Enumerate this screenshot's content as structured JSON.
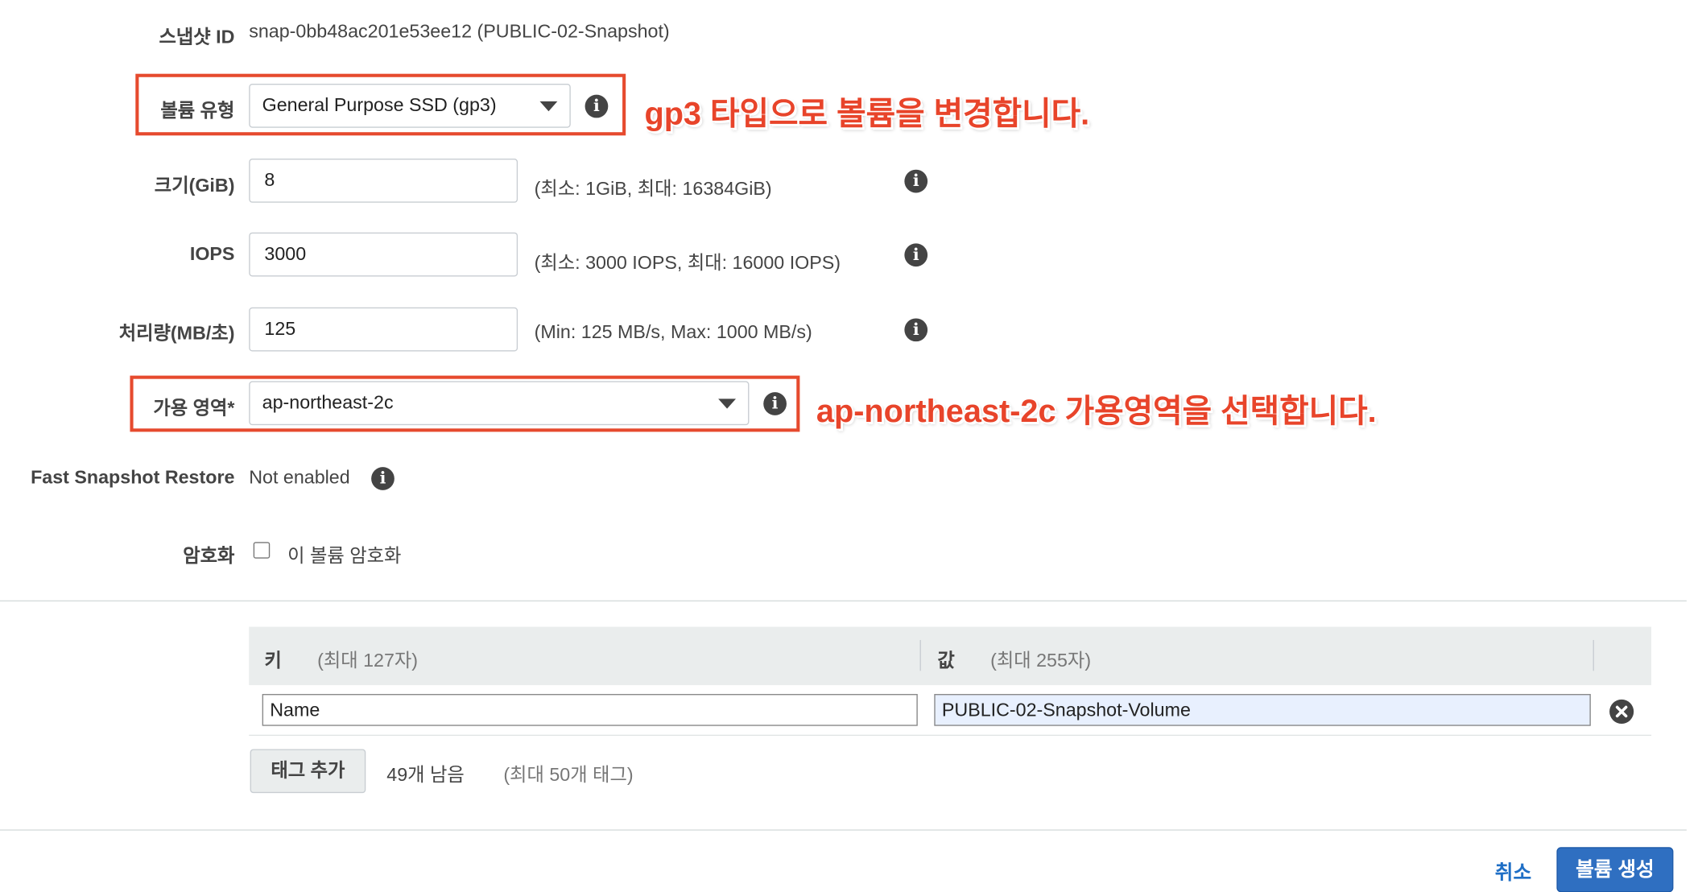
{
  "snapshot": {
    "label": "스냅샷 ID",
    "value": "snap-0bb48ac201e53ee12 (PUBLIC-02-Snapshot)"
  },
  "volume_type": {
    "label": "볼륨 유형",
    "value": "General Purpose SSD (gp3)"
  },
  "size": {
    "label": "크기(GiB)",
    "value": "8",
    "hint": "(최소: 1GiB, 최대: 16384GiB)"
  },
  "iops": {
    "label": "IOPS",
    "value": "3000",
    "hint": "(최소: 3000 IOPS, 최대: 16000 IOPS)"
  },
  "throughput": {
    "label": "처리량(MB/초)",
    "value": "125",
    "hint": "(Min: 125 MB/s, Max: 1000 MB/s)"
  },
  "availability_zone": {
    "label": "가용 영역*",
    "value": "ap-northeast-2c"
  },
  "fast_snapshot_restore": {
    "label": "Fast Snapshot Restore",
    "value": "Not enabled"
  },
  "encryption": {
    "label": "암호화",
    "checkbox_label": "이 볼륨 암호화",
    "checked": false
  },
  "annotations": {
    "volume_type_note": "gp3 타입으로 볼륨을 변경합니다.",
    "az_note": "ap-northeast-2c 가용영역을 선택합니다."
  },
  "tags": {
    "key_header": "키",
    "key_hint": "(최대 127자)",
    "value_header": "값",
    "value_hint": "(최대 255자)",
    "rows": [
      {
        "key": "Name",
        "value": "PUBLIC-02-Snapshot-Volume"
      }
    ],
    "add_button": "태그 추가",
    "remaining": "49개 남음",
    "max_hint": "(최대 50개 태그)"
  },
  "footer": {
    "cancel_label": "취소",
    "create_label": "볼륨 생성"
  },
  "colors": {
    "annotation_red": "#e8442a",
    "primary_blue": "#2f6fc1",
    "link_blue": "#1f6fc6"
  },
  "icons": {
    "info": "info-icon",
    "dropdown": "caret-down-icon",
    "remove": "remove-circle-icon"
  }
}
